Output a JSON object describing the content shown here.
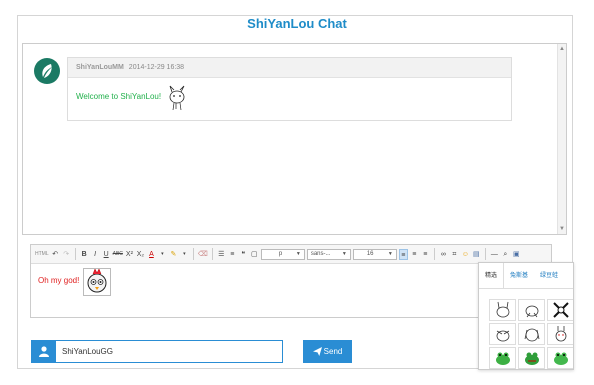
{
  "app": {
    "title": "ShiYanLou Chat"
  },
  "chat": {
    "messages": [
      {
        "user": "ShiYanLouMM",
        "time": "2014-12-29 16:38",
        "text": "Welcome to ShiYanLou!"
      }
    ]
  },
  "editor": {
    "toolbar": {
      "html_label": "HTML",
      "bold": "B",
      "italic": "I",
      "underline": "U",
      "strike": "ABC",
      "superscript": "X²",
      "subscript": "X₂",
      "font_color": "A",
      "paragraph_value": "p",
      "font_family_value": "sans-...",
      "font_size_value": "16"
    },
    "content_text": "Oh my god!"
  },
  "emoji_panel": {
    "tabs": [
      "精选",
      "兔斯基",
      "绿豆蛙"
    ],
    "active_tab": 0
  },
  "username": {
    "value": "ShiYanLouGG"
  },
  "send_button": {
    "label": "Send"
  },
  "colors": {
    "accent": "#2a8dd4",
    "title": "#1e8cc8",
    "welcome": "#22b14c",
    "editor_text": "#e02020"
  }
}
